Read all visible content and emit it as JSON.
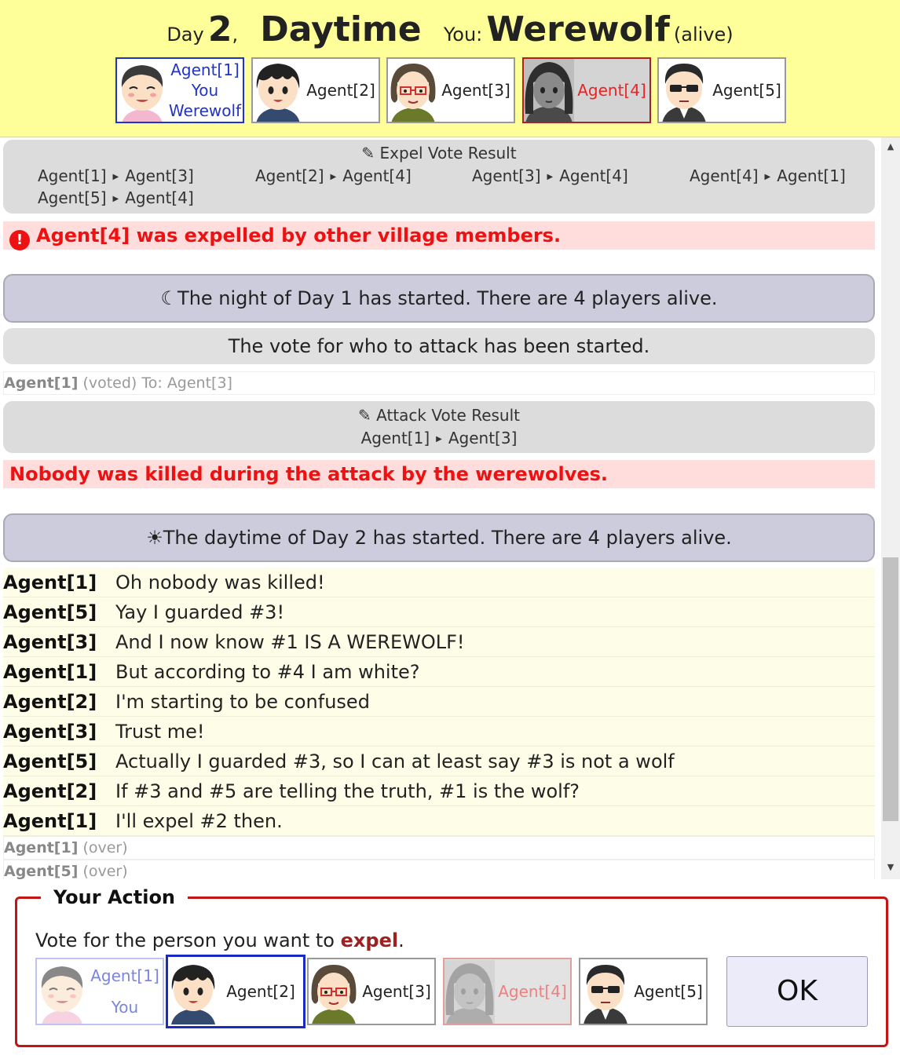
{
  "header": {
    "day_prefix": "Day",
    "day_number": "2",
    "comma": ",",
    "phase": "Daytime",
    "you_label": "You:",
    "role": "Werewolf",
    "status": "(alive)"
  },
  "agents": [
    {
      "line1": "Agent[1]",
      "line2": "You",
      "line3": "Werewolf",
      "state": "me",
      "face": "smiling-man"
    },
    {
      "line1": "Agent[2]",
      "state": "alive",
      "face": "boy"
    },
    {
      "line1": "Agent[3]",
      "state": "alive",
      "face": "woman-glasses"
    },
    {
      "line1": "Agent[4]",
      "state": "dead",
      "face": "girl"
    },
    {
      "line1": "Agent[5]",
      "state": "alive",
      "face": "man-sunglasses"
    }
  ],
  "log": {
    "expel_vote": {
      "title": "Expel Vote Result",
      "rows": [
        {
          "from": "Agent[1]",
          "to": "Agent[3]"
        },
        {
          "from": "Agent[2]",
          "to": "Agent[4]"
        },
        {
          "from": "Agent[3]",
          "to": "Agent[4]"
        },
        {
          "from": "Agent[4]",
          "to": "Agent[1]"
        },
        {
          "from": "Agent[5]",
          "to": "Agent[4]"
        }
      ]
    },
    "expelled_msg": "Agent[4] was expelled by other village members.",
    "night_start": "The night of Day 1 has started. There are 4 players alive.",
    "attack_vote_started": "The vote for who to attack has been started.",
    "attack_voted": {
      "agent": "Agent[1]",
      "text": "(voted) To: Agent[3]"
    },
    "attack_vote": {
      "title": "Attack Vote Result",
      "rows": [
        {
          "from": "Agent[1]",
          "to": "Agent[3]"
        }
      ]
    },
    "nobody_killed": "Nobody was killed during the attack by the werewolves.",
    "day_start": "The daytime of Day 2 has started. There are 4 players alive.",
    "talks": [
      {
        "agent": "Agent[1]",
        "text": "Oh nobody was killed!"
      },
      {
        "agent": "Agent[5]",
        "text": "Yay I guarded #3!"
      },
      {
        "agent": "Agent[3]",
        "text": "And I now know #1 IS A WEREWOLF!"
      },
      {
        "agent": "Agent[1]",
        "text": "But according to #4 I am white?"
      },
      {
        "agent": "Agent[2]",
        "text": "I'm starting to be confused"
      },
      {
        "agent": "Agent[3]",
        "text": "Trust me!"
      },
      {
        "agent": "Agent[5]",
        "text": "Actually I guarded #3, so I can at least say #3 is not a wolf"
      },
      {
        "agent": "Agent[2]",
        "text": "If #3 and #5 are telling the truth, #1 is the wolf?"
      },
      {
        "agent": "Agent[1]",
        "text": "I'll expel #2 then."
      }
    ],
    "over_lines": [
      {
        "agent": "Agent[1]",
        "text": "(over)"
      },
      {
        "agent": "Agent[5]",
        "text": "(over)"
      }
    ]
  },
  "action": {
    "legend": "Your Action",
    "instruction_prefix": "Vote for the person you want to ",
    "instruction_keyword": "expel",
    "instruction_suffix": ".",
    "candidates": [
      {
        "line1": "Agent[1]",
        "line2": "You",
        "state": "self",
        "face": "smiling-man"
      },
      {
        "line1": "Agent[2]",
        "state": "selected",
        "face": "boy"
      },
      {
        "line1": "Agent[3]",
        "state": "alive",
        "face": "woman-glasses"
      },
      {
        "line1": "Agent[4]",
        "state": "dead",
        "face": "girl"
      },
      {
        "line1": "Agent[5]",
        "state": "alive",
        "face": "man-sunglasses"
      }
    ],
    "ok_label": "OK"
  },
  "colors": {
    "header_bg": "#ffff99",
    "self_blue": "#2233cc",
    "dead_red": "#ee2222",
    "alert_red": "#ee1111",
    "alert_bg": "#ffdddd",
    "phase_bg": "#ccccdd",
    "talk_bg": "#fdfde8",
    "action_border": "#c41414"
  }
}
